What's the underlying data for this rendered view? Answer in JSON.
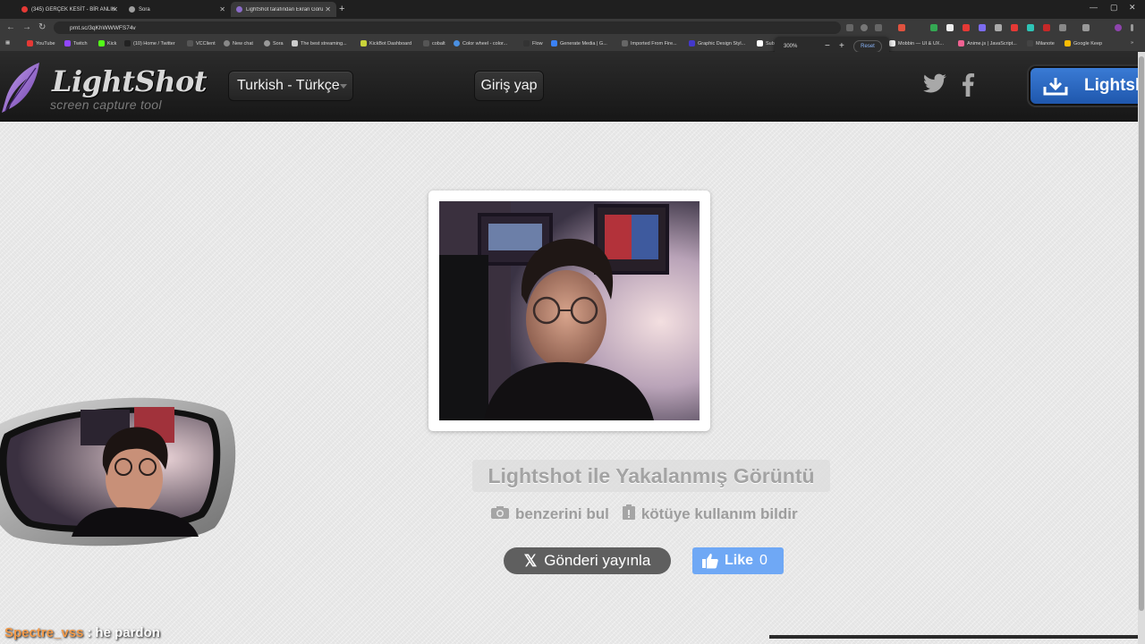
{
  "browser": {
    "tabs": [
      {
        "title": "(345) GERÇEK KESİT - BİR ANLIK",
        "active": false,
        "color": "#e53935"
      },
      {
        "title": "Sora",
        "active": false,
        "color": "#9e9e9e"
      },
      {
        "title": "LightShot tarafından Ekran Görü",
        "active": true,
        "color": "#8b6cc9"
      }
    ],
    "url": "prnt.sc/3qKhWWWFS74v",
    "bookmarks": [
      "YouTube",
      "Twitch",
      "Kick",
      "(10) Home / Twitter",
      "VCClient",
      "New chat",
      "Sora",
      "The best streaming...",
      "KickBot Dashboard",
      "cobalt",
      "Color wheel - color...",
      "Flow",
      "Generate Media | G...",
      "Imported From Fire...",
      "Graphic Design Styl...",
      "Sub",
      "Mobbin — UI & UX...",
      "Anime.js | JavaScript...",
      "Milanote",
      "Google Keep"
    ],
    "zoom": {
      "value": "300%",
      "minus": "−",
      "plus": "+",
      "reset": "Reset"
    }
  },
  "header": {
    "logo_title": "LightShot",
    "logo_subtitle": "screen capture tool",
    "language": "Turkish - Türkçe",
    "login": "Giriş yap",
    "download": "Lightsh"
  },
  "content": {
    "caption": "Lightshot ile Yakalanmış Görüntü",
    "find_similar": "benzerini bul",
    "report_abuse": "kötüye kullanım bildir",
    "tweet_button": "Gönderi yayınla",
    "like_label": "Like",
    "like_count": "0"
  },
  "overlay": {
    "chat_user": "Spectre_vss",
    "chat_separator": ":",
    "chat_message": "he pardon"
  }
}
